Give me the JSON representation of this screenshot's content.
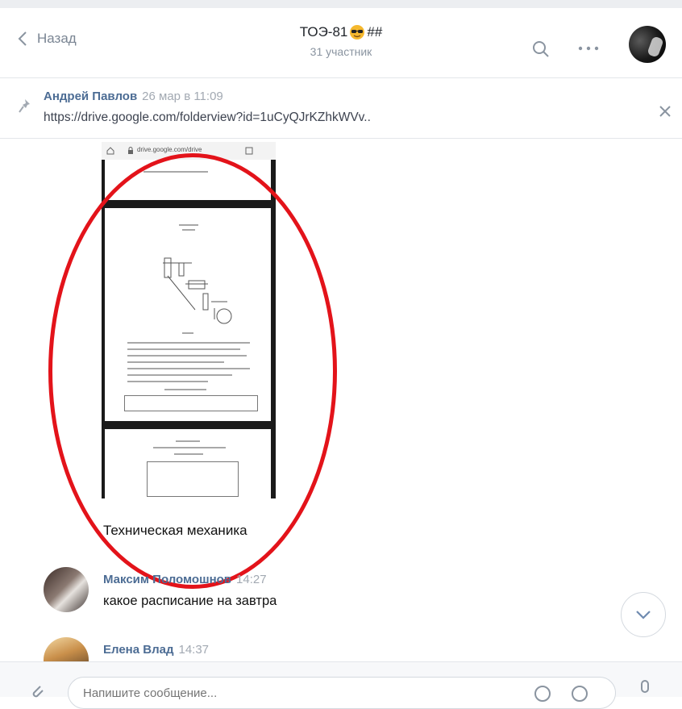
{
  "header": {
    "back_label": "Назад",
    "title": "ТОЭ-81",
    "title_suffix": "##",
    "subtitle": "31 участник"
  },
  "pinned": {
    "author": "Андрей Павлов",
    "time": "26 мар в 11:09",
    "link": "https://drive.google.com/folderview?id=1uCyQJrKZhkWVv.."
  },
  "attachment": {
    "url_text": "drive.google.com/drive",
    "caption": "Техническая механика"
  },
  "messages": [
    {
      "author": "Максим Поломошнов",
      "time": "14:27",
      "text": "какое расписание на завтра"
    },
    {
      "author": "Елена Влад",
      "time": "14:37"
    }
  ],
  "composer": {
    "placeholder": "Напишите сообщение..."
  },
  "colors": {
    "accent": "#4c6c94",
    "annotation": "#e3131a"
  }
}
